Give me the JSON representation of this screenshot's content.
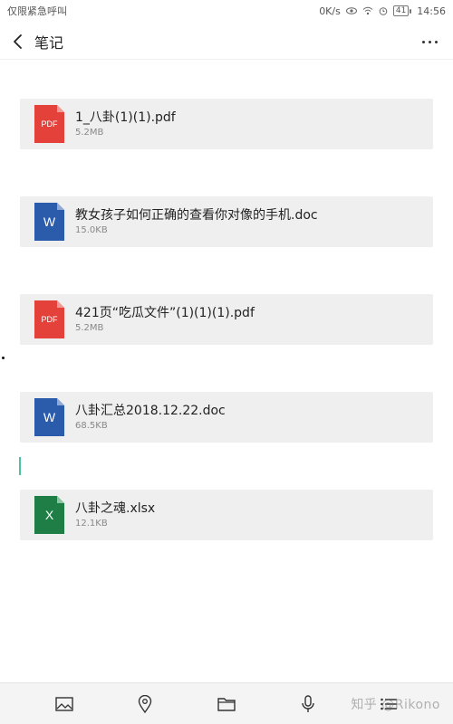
{
  "status_bar": {
    "carrier": "仅限紧急呼叫",
    "speed": "0K/s",
    "battery": "41",
    "time": "14:56"
  },
  "header": {
    "title": "笔记"
  },
  "files": [
    {
      "name": "1_八卦(1)(1).pdf",
      "size": "5.2MB",
      "type": "pdf",
      "icon_label": "PDF",
      "color": "#e5413b"
    },
    {
      "name": "教女孩子如何正确的查看你对像的手机.doc",
      "size": "15.0KB",
      "type": "doc",
      "icon_label": "W",
      "color": "#2b5bab"
    },
    {
      "name": "421页“吃瓜文件”(1)(1)(1).pdf",
      "size": "5.2MB",
      "type": "pdf",
      "icon_label": "PDF",
      "color": "#e5413b"
    },
    {
      "name": "八卦汇总2018.12.22.doc",
      "size": "68.5KB",
      "type": "doc",
      "icon_label": "W",
      "color": "#2b5bab"
    },
    {
      "name": "八卦之魂.xlsx",
      "size": "12.1KB",
      "type": "xlsx",
      "icon_label": "X",
      "color": "#1e7e45"
    }
  ],
  "toolbar": {
    "icons": [
      "image-icon",
      "location-icon",
      "folder-icon",
      "microphone-icon",
      "checklist-icon"
    ]
  },
  "watermark": "知乎 @Rikono"
}
